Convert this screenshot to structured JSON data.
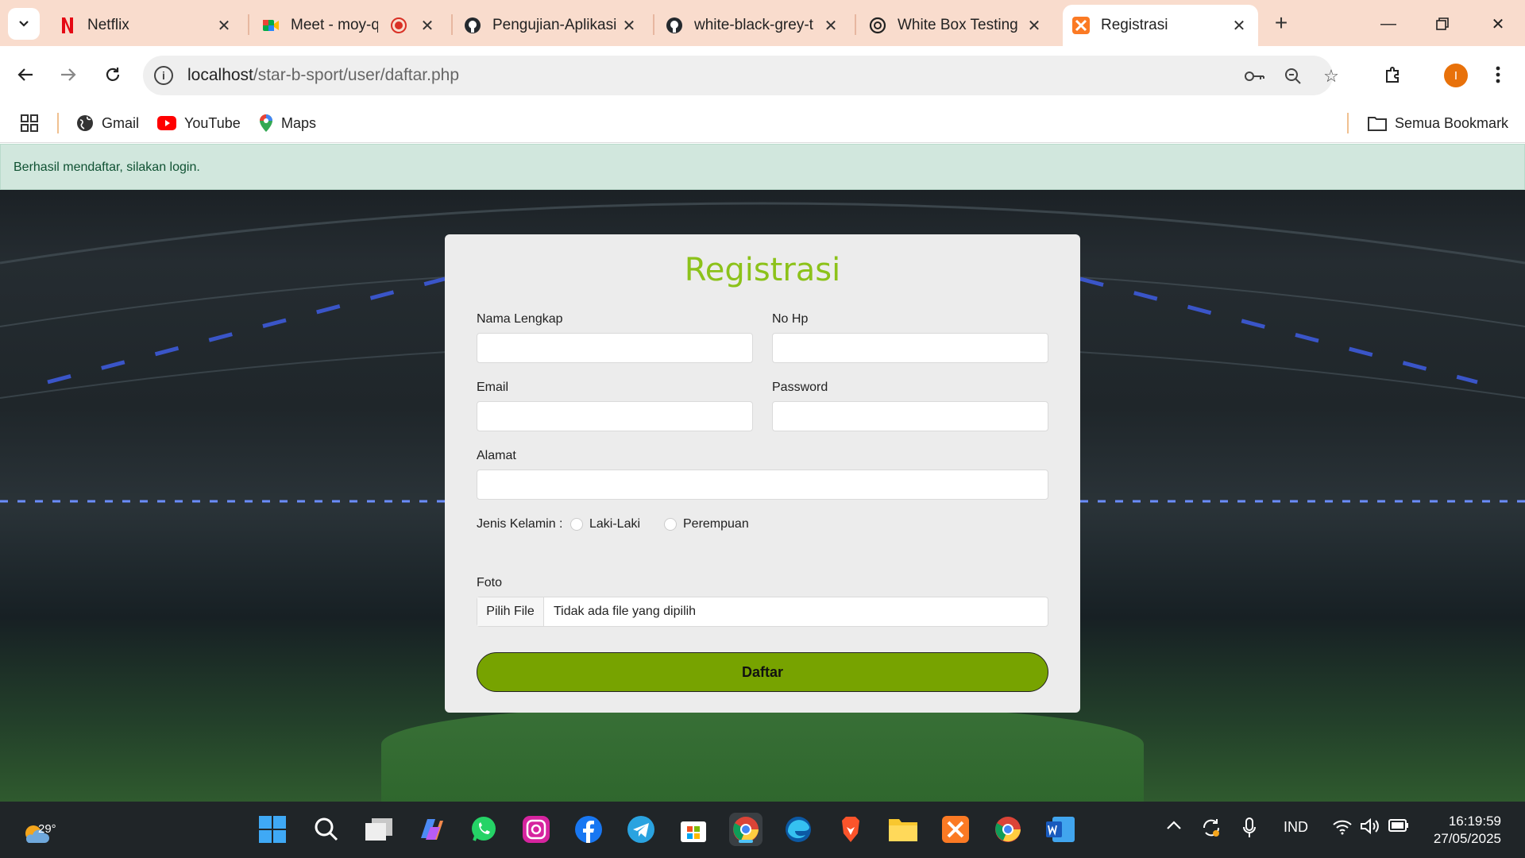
{
  "browser": {
    "tabs": [
      {
        "title": "Netflix",
        "favicon": "netflix-icon",
        "color": "#e50914"
      },
      {
        "title": "Meet - moy-qb",
        "favicon": "google-meet-icon",
        "color": "#00832d"
      },
      {
        "title": "Pengujian-Aplikasi",
        "favicon": "github-icon",
        "color": "#24292e"
      },
      {
        "title": "white-black-grey-t",
        "favicon": "github-icon",
        "color": "#24292e"
      },
      {
        "title": "White Box Testing",
        "favicon": "chatgpt-icon",
        "color": "#222222"
      },
      {
        "title": "Registrasi",
        "favicon": "xampp-icon",
        "color": "#fb7a24"
      }
    ],
    "new_tab": "+",
    "url_host": "localhost",
    "url_path": "/star-b-sport/user/daftar.php",
    "profile_initial": "I",
    "bookmarks": [
      {
        "label": "Gmail",
        "icon": "globe-icon"
      },
      {
        "label": "YouTube",
        "icon": "youtube-icon"
      },
      {
        "label": "Maps",
        "icon": "maps-icon"
      }
    ],
    "all_bookmarks": "Semua Bookmark"
  },
  "page": {
    "alert": "Berhasil mendaftar, silakan login.",
    "heading": "Registrasi",
    "accent": "#8cc21a",
    "fields": {
      "nama": "Nama Lengkap",
      "hp": "No Hp",
      "email": "Email",
      "password": "Password",
      "alamat": "Alamat"
    },
    "gender_label": "Jenis Kelamin :",
    "gender_options": [
      "Laki-Laki",
      "Perempuan"
    ],
    "foto_label": "Foto",
    "file_button": "Pilih File",
    "file_status": "Tidak ada file yang dipilih",
    "submit": "Daftar",
    "submit_color": "#77a300"
  },
  "taskbar": {
    "weather_temp": "29°",
    "language": "IND",
    "time": "16:19:59",
    "date": "27/05/2025"
  }
}
